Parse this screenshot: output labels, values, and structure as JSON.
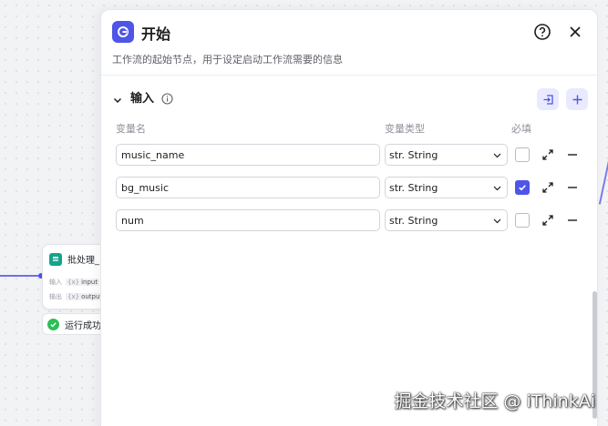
{
  "canvas": {
    "batch_node": {
      "title": "批处理_",
      "rows": [
        {
          "label": "输入",
          "type": "{x}",
          "name": "input"
        },
        {
          "label": "输出",
          "type": "{x}",
          "name": "output"
        }
      ]
    },
    "run_status": {
      "label": "运行成功"
    }
  },
  "panel": {
    "title": "开始",
    "description": "工作流的起始节点，用于设定启动工作流需要的信息",
    "section": {
      "title": "输入"
    },
    "columns": {
      "name": "变量名",
      "type": "变量类型",
      "required": "必填"
    },
    "variables": [
      {
        "name": "music_name",
        "type": "str. String",
        "required": false
      },
      {
        "name": "bg_music",
        "type": "str. String",
        "required": true
      },
      {
        "name": "num",
        "type": "str. String",
        "required": false
      }
    ]
  },
  "watermark": "掘金技术社区 @ iThinkAi",
  "colors": {
    "accent": "#4e55e7",
    "success": "#2ebd57",
    "batch": "#12a58c"
  }
}
